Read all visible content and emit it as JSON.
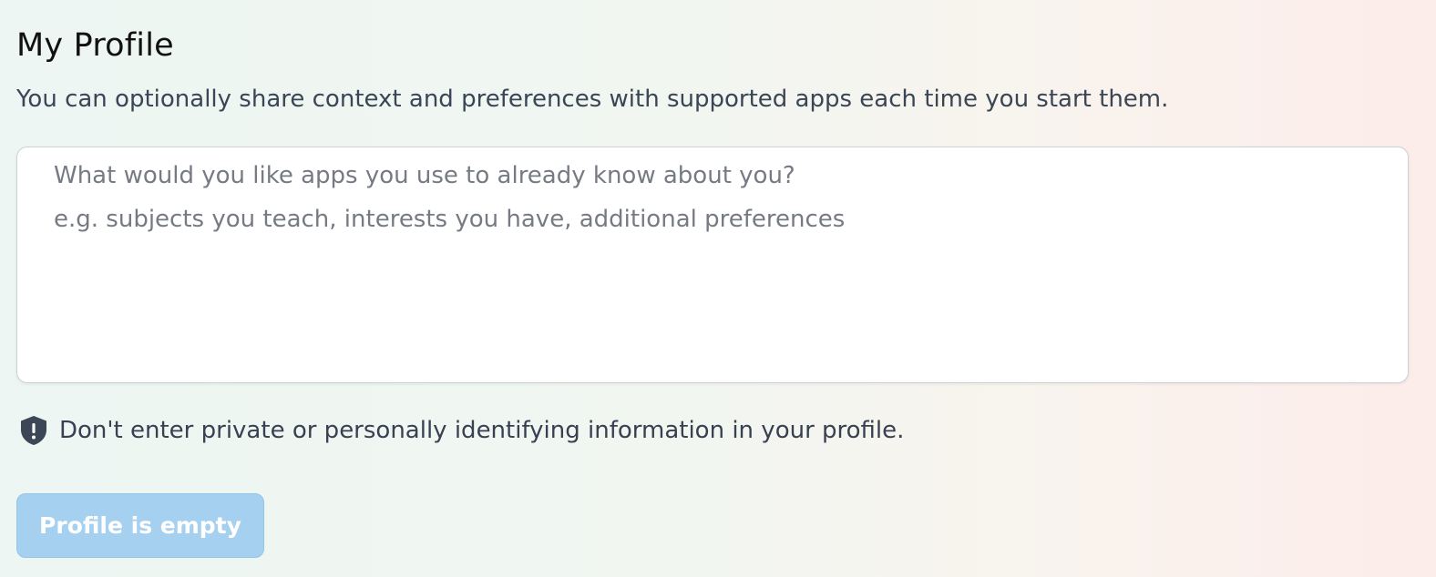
{
  "page": {
    "title": "My Profile",
    "description": "You can optionally share context and preferences with supported apps each time you start them."
  },
  "profile_input": {
    "value": "",
    "placeholder_line1": "What would you like apps you use to already know about you?",
    "placeholder_line2": "e.g. subjects you teach, interests you have, additional preferences"
  },
  "warning": {
    "icon": "shield-alert-icon",
    "text": "Don't enter private or personally identifying information in your profile."
  },
  "actions": {
    "save_label": "Profile is empty",
    "save_enabled": false
  },
  "colors": {
    "button_disabled_bg": "#a6d0ef",
    "shield_icon": "#3b4656"
  }
}
